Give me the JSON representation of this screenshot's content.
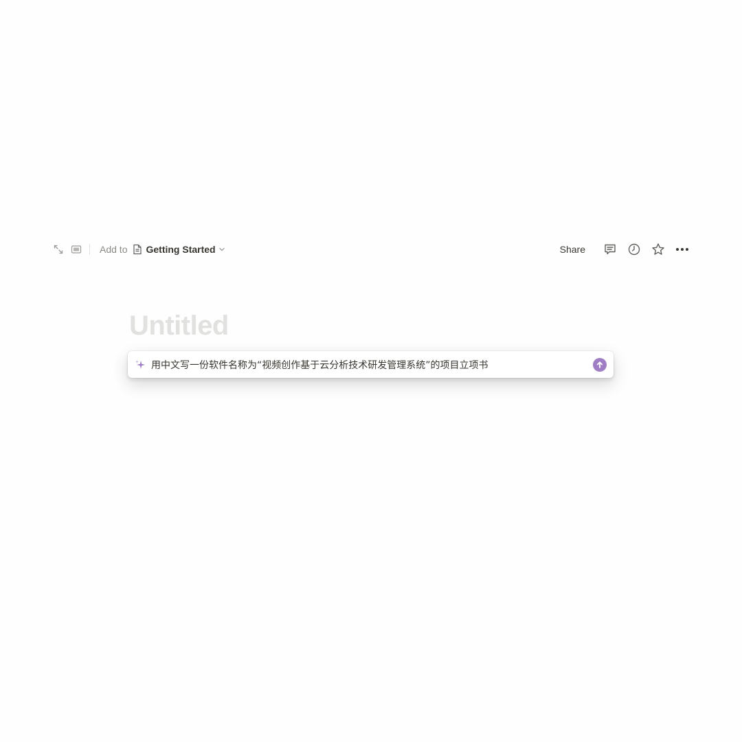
{
  "topbar": {
    "expand_icon": "expand-diagonal-icon",
    "peek_icon": "side-peek-icon",
    "add_to_label": "Add to",
    "page_link": {
      "icon": "document-icon",
      "label": "Getting Started",
      "chevron": "chevron-down-icon"
    },
    "share_label": "Share",
    "right_icons": [
      "comment-icon",
      "clock-history-icon",
      "star-icon",
      "more-dots-icon"
    ]
  },
  "page": {
    "title_placeholder": "Untitled"
  },
  "ai_prompt": {
    "icon": "sparkle-icon",
    "value": "用中文写一份软件名称为“视频创作基于云分析技术研发管理系统”的项目立项书",
    "send_icon": "arrow-up-circle-icon",
    "accent_color": "#a07ec6"
  }
}
